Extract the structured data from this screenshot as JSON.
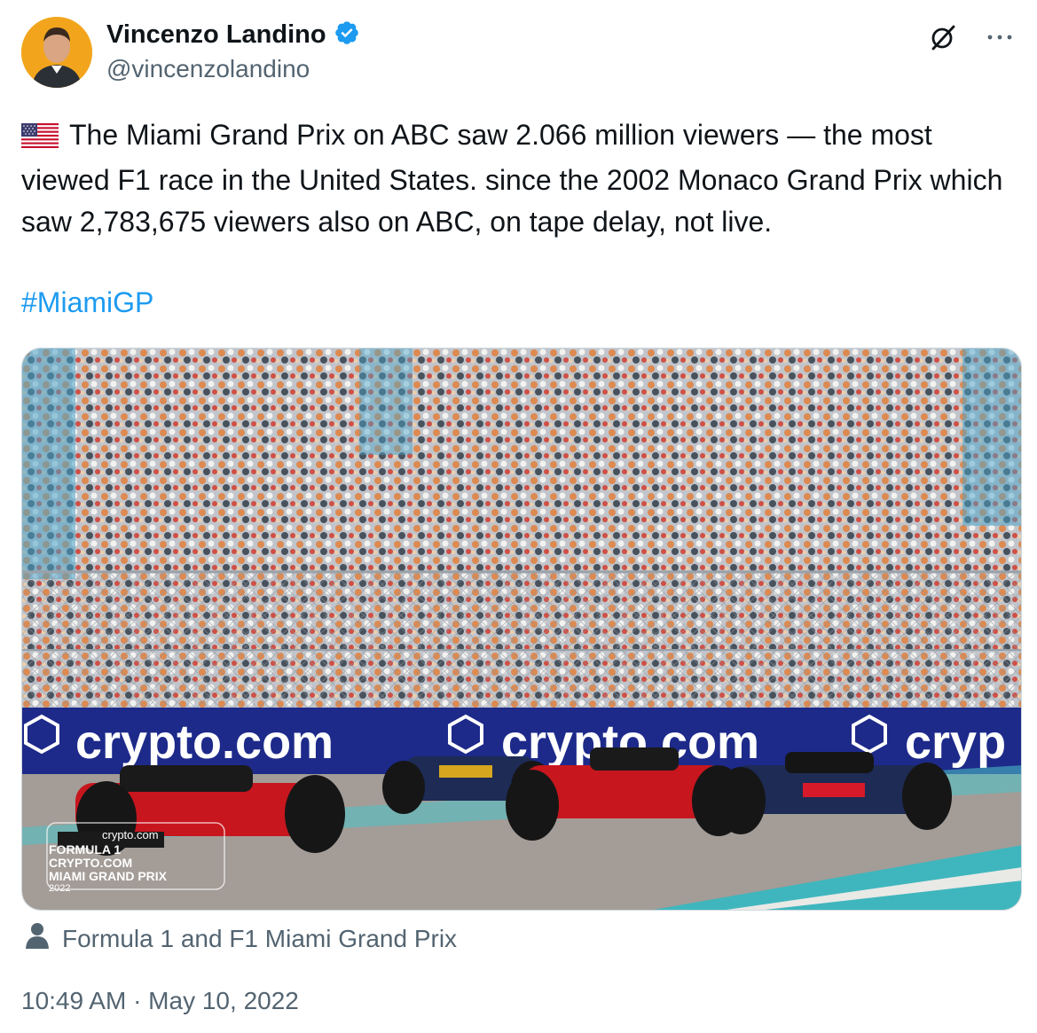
{
  "author": {
    "name": "Vincenzo Landino",
    "handle": "@vincenzolandino",
    "verified": true,
    "verified_color": "#1d9bf0"
  },
  "icons": {
    "grok": "grok-icon",
    "more": "more-options-icon"
  },
  "tweet": {
    "flag": "us-flag-emoji",
    "text": "The Miami Grand Prix on ABC saw 2.066 million viewers — the most viewed F1 race in the United States. since the 2002 Monaco Grand Prix which saw 2,783,675 viewers also on ABC, on tape delay, not live.",
    "hashtag": "#MiamiGP",
    "link_color": "#1d9bf0"
  },
  "media": {
    "banner_text_1": "crypto.com",
    "banner_text_2": "crypto.com",
    "banner_text_3": "cryp",
    "watermark": {
      "brand": "crypto.com",
      "line1": "FORMULA 1",
      "line2": "CRYPTO.COM",
      "line3": "MIAMI GRAND PRIX",
      "year": "2022"
    }
  },
  "media_credit": "Formula 1 and F1 Miami Grand Prix",
  "timestamp": "10:49 AM · May 10, 2022"
}
